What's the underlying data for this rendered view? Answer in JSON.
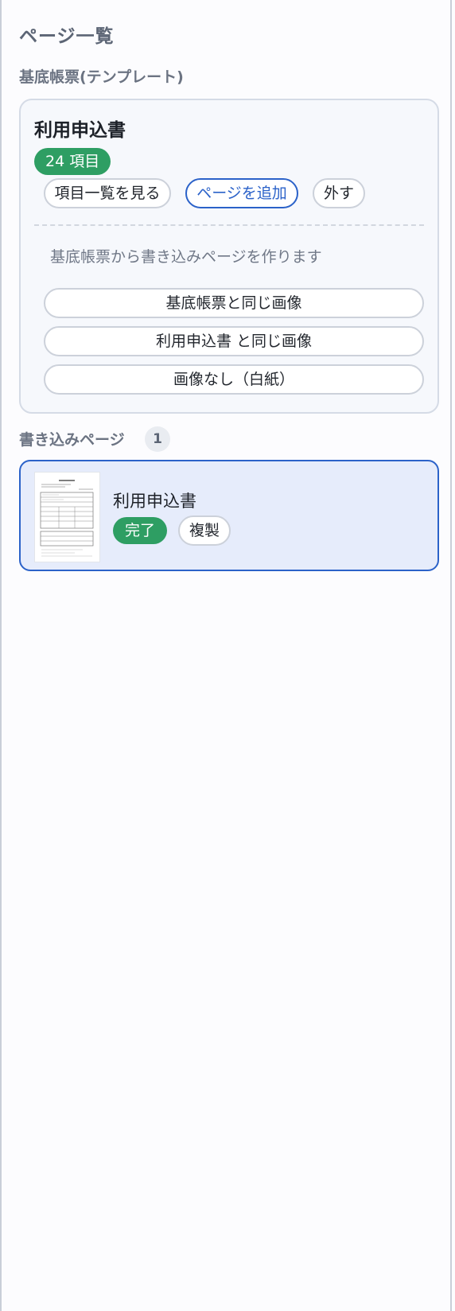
{
  "panel": {
    "title": "ページ一覧"
  },
  "templates_section": {
    "label": "基底帳票(テンプレート)",
    "card": {
      "title": "利用申込書",
      "item_count_badge": "24 項目",
      "actions": {
        "view_items": "項目一覧を見る",
        "add_page": "ページを追加",
        "remove": "外す"
      },
      "hint": "基底帳票から書き込みページを作ります",
      "create_options": [
        "基底帳票と同じ画像",
        "利用申込書 と同じ画像",
        "画像なし（白紙）"
      ]
    }
  },
  "pages_section": {
    "label": "書き込みページ",
    "count": "1",
    "pages": [
      {
        "name": "利用申込書",
        "status": "完了",
        "duplicate_label": "複製"
      }
    ]
  },
  "colors": {
    "accent_blue": "#2b62c9",
    "success_green": "#2e9e63",
    "selected_card_bg": "#e6ecfb"
  }
}
